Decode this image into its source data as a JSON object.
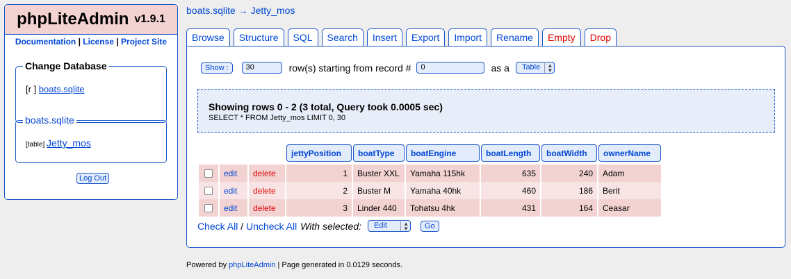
{
  "app": {
    "name": "phpLiteAdmin",
    "version": "v1.9.1"
  },
  "left_links": {
    "documentation": "Documentation",
    "sep": " | ",
    "license": "License",
    "project_site": "Project Site"
  },
  "change_db": {
    "legend": "Change Database",
    "prefix": "[r ]",
    "db_name": "boats.sqlite"
  },
  "table_box": {
    "legend": "boats.sqlite",
    "prefix": "[table]",
    "table_name": "Jetty_mos"
  },
  "logout_label": "Log Out",
  "breadcrumb": {
    "db": "boats.sqlite",
    "arrow": " → ",
    "table": "Jetty_mos"
  },
  "tabs": [
    {
      "label": "Browse",
      "active": true
    },
    {
      "label": "Structure"
    },
    {
      "label": "SQL"
    },
    {
      "label": "Search"
    },
    {
      "label": "Insert"
    },
    {
      "label": "Export"
    },
    {
      "label": "Import"
    },
    {
      "label": "Rename"
    },
    {
      "label": "Empty",
      "danger": true
    },
    {
      "label": "Drop",
      "danger": true
    }
  ],
  "show_form": {
    "show_button": "Show :",
    "rows_value": "30",
    "rows_text": "row(s) starting from record #",
    "record_value": "0",
    "as_text": "as a",
    "view_mode": "Table"
  },
  "message": {
    "title": "Showing rows 0 - 2 (3 total, Query took 0.0005 sec)",
    "query": "SELECT * FROM Jetty_mos LIMIT 0, 30"
  },
  "table": {
    "columns": [
      "jettyPosition",
      "boatType",
      "boatEngine",
      "boatLength",
      "boatWidth",
      "ownerName"
    ],
    "edit_label": "edit",
    "delete_label": "delete",
    "rows": [
      [
        "1",
        "Buster XXL",
        "Yamaha 115hk",
        "635",
        "240",
        "Adam"
      ],
      [
        "2",
        "Buster M",
        "Yamaha 40hk",
        "460",
        "186",
        "Berit"
      ],
      [
        "3",
        "Linder 440",
        "Tohatsu 4hk",
        "431",
        "164",
        "Ceasar"
      ]
    ]
  },
  "bottom": {
    "check_all": "Check All",
    "sep": " / ",
    "uncheck_all": "Uncheck All",
    "with_selected": "With selected:",
    "action": "Edit",
    "go": "Go"
  },
  "footer": {
    "prefix": "Powered by ",
    "link": "phpLiteAdmin",
    "suffix": " | Page generated in 0.0129 seconds."
  },
  "colors": {
    "accent": "#1b57c9",
    "link": "#0046d5",
    "danger": "#e00000",
    "row_pink": "#f3d2d2",
    "row_light": "#f8e4e4"
  }
}
